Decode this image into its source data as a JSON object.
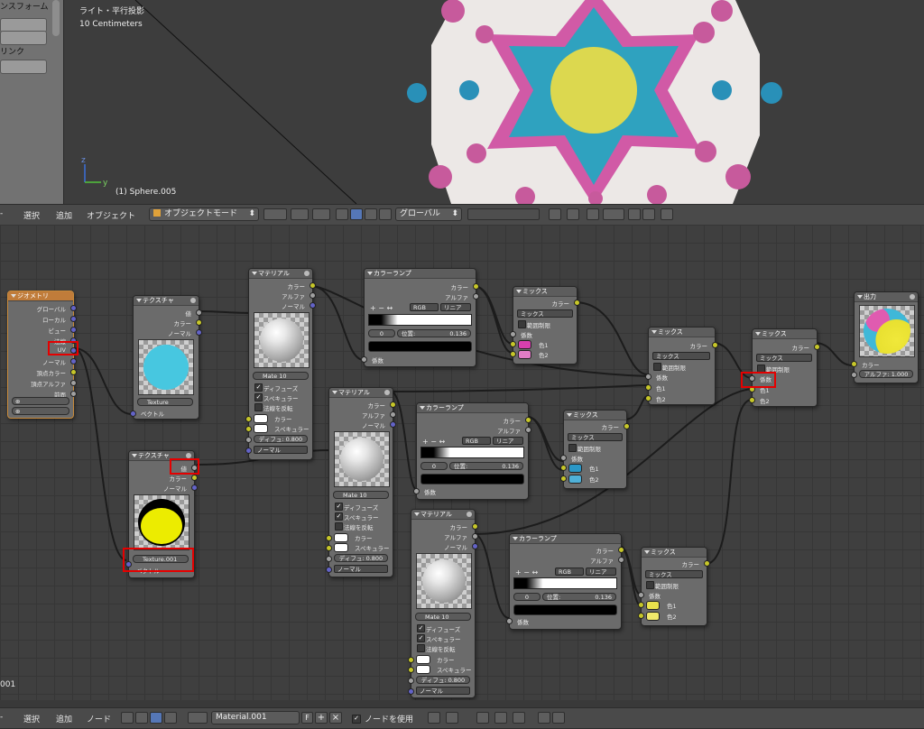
{
  "viewport": {
    "tools_label_1": "ンスフォーム",
    "tools_label_2": "リンク",
    "view_name": "ライト・平行投影",
    "grid_scale": "10 Centimeters",
    "object_name": "(1) Sphere.005",
    "left_edge_label": "001"
  },
  "header3d": {
    "menu": [
      "選択",
      "追加",
      "オブジェクト"
    ],
    "mode": "オブジェクトモード",
    "orientation": "グローバル"
  },
  "nodes": {
    "geometry": {
      "title": "ジオメトリ",
      "outputs": [
        "グローバル",
        "ローカル",
        "ビュー",
        "法線",
        "UV",
        "ノーマル",
        "頂点カラー",
        "頂点アルファ",
        "前面"
      ]
    },
    "texture1": {
      "title": "テクスチャ",
      "outputs": [
        "値",
        "カラー",
        "ノーマル"
      ],
      "tex_name": "Texture",
      "input": "ベクトル"
    },
    "texture2": {
      "title": "テクスチャ",
      "outputs": [
        "値",
        "カラー",
        "ノーマル"
      ],
      "tex_name": "Texture.001",
      "input": "ベクトル"
    },
    "material1": {
      "title": "マテリアル",
      "outputs": [
        "カラー",
        "アルファ",
        "ノーマル"
      ],
      "mat_name": "Mate",
      "users": "10",
      "diffuse": "ディフューズ",
      "specular": "スペキュラー",
      "invert": "法線を反転",
      "in_color": "カラー",
      "in_spec": "スペキュラー",
      "diffuse_val": "ディフュ: 0.800",
      "normal": "ノーマル"
    },
    "material2": {
      "title": "マテリアル",
      "outputs": [
        "カラー",
        "アルファ",
        "ノーマル"
      ],
      "mat_name": "Mate",
      "users": "10",
      "diffuse": "ディフューズ",
      "specular": "スペキュラー",
      "invert": "法線を反転",
      "in_color": "カラー",
      "in_spec": "スペキュラー",
      "diffuse_val": "ディフュ: 0.800",
      "normal": "ノーマル"
    },
    "material3": {
      "title": "マテリアル",
      "outputs": [
        "カラー",
        "アルファ",
        "ノーマル"
      ],
      "mat_name": "Mate",
      "users": "10",
      "diffuse": "ディフューズ",
      "specular": "スペキュラー",
      "invert": "法線を反転",
      "in_color": "カラー",
      "in_spec": "スペキュラー",
      "diffuse_val": "ディフュ: 0.800",
      "normal": "ノーマル"
    },
    "ramp1": {
      "title": "カラーランプ",
      "outputs": [
        "カラー",
        "アルファ"
      ],
      "mode": "RGB",
      "interp": "リニア",
      "index": "0",
      "pos": "位置:",
      "pos_val": "0.136",
      "factor": "係数"
    },
    "ramp2": {
      "title": "カラーランプ",
      "outputs": [
        "カラー",
        "アルファ"
      ],
      "mode": "RGB",
      "interp": "リニア",
      "index": "0",
      "pos": "位置:",
      "pos_val": "0.136",
      "factor": "係数"
    },
    "ramp3": {
      "title": "カラーランプ",
      "outputs": [
        "カラー",
        "アルファ"
      ],
      "mode": "RGB",
      "interp": "リニア",
      "index": "0",
      "pos": "位置:",
      "pos_val": "0.136",
      "factor": "係数"
    },
    "mix1": {
      "title": "ミックス",
      "output": "カラー",
      "mode": "ミックス",
      "clamp": "範囲制限",
      "factor": "係数",
      "c1": "色1",
      "c2": "色2",
      "color1": "#d63fae",
      "color2": "#e27cc6"
    },
    "mix2": {
      "title": "ミックス",
      "output": "カラー",
      "mode": "ミックス",
      "clamp": "範囲制限",
      "factor": "係数",
      "c1": "色1",
      "c2": "色2",
      "color1": "#2a97c6",
      "color2": "#4fb0d8"
    },
    "mix3": {
      "title": "ミックス",
      "output": "カラー",
      "mode": "ミックス",
      "clamp": "範囲制限",
      "factor": "係数",
      "c1": "色1",
      "c2": "色2",
      "color1": "#e8e14c",
      "color2": "#efe86b"
    },
    "mix4": {
      "title": "ミックス",
      "output": "カラー",
      "mode": "ミックス",
      "clamp": "範囲制限",
      "factor": "係数",
      "c1": "色1",
      "c2": "色2"
    },
    "mix5": {
      "title": "ミックス",
      "output": "カラー",
      "mode": "ミックス",
      "clamp": "範囲制限",
      "factor": "係数",
      "c1": "色1",
      "c2": "色2"
    },
    "output": {
      "title": "出力",
      "color": "カラー",
      "alpha": "アルファ: 1.000"
    }
  },
  "header_nodes": {
    "menu": [
      "選択",
      "追加",
      "ノード"
    ],
    "material": "Material.001",
    "fake_user": "F",
    "use_nodes": "ノードを使用"
  }
}
